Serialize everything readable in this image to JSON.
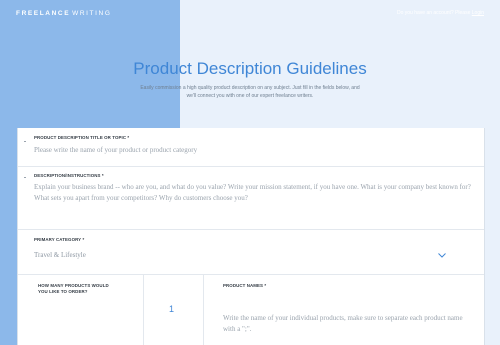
{
  "header": {
    "logo_bold": "FREELANCE",
    "logo_thin": "WRITING",
    "account_prompt": "Do you have an account? Please",
    "login_link": "Login"
  },
  "page": {
    "title": "Product Description Guidelines",
    "subtitle": "Easily commission a high quality product description on any subject. Just fill in the fields below, and we'll connect you with one of our expert freelance writers."
  },
  "form": {
    "title_field": {
      "label": "PRODUCT DESCRIPTION TITLE OR TOPIC *",
      "placeholder": "Please write the name of your product or product category"
    },
    "description_field": {
      "label": "DESCRIPTION/INSTRUCTIONS *",
      "placeholder": "Explain your business brand -- who are you, and what do you value? Write your mission statement, if you have one. What is your company best known for? What sets you apart from your competitors? Why do customers choose you?"
    },
    "category_field": {
      "label": "PRIMARY CATEGORY *",
      "value": "Travel & Lifestyle"
    },
    "quantity_field": {
      "label": "HOW MANY PRODUCTS WOULD YOU LIKE TO ORDER?",
      "value": "1"
    },
    "names_field": {
      "label": "PRODUCT NAMES *",
      "placeholder": "Write the name of your individual products, make sure to separate each product name with a \";\"."
    }
  },
  "colors": {
    "accent": "#3f86d6",
    "left_panel": "#8cb8ea",
    "background": "#e9f1fb"
  }
}
